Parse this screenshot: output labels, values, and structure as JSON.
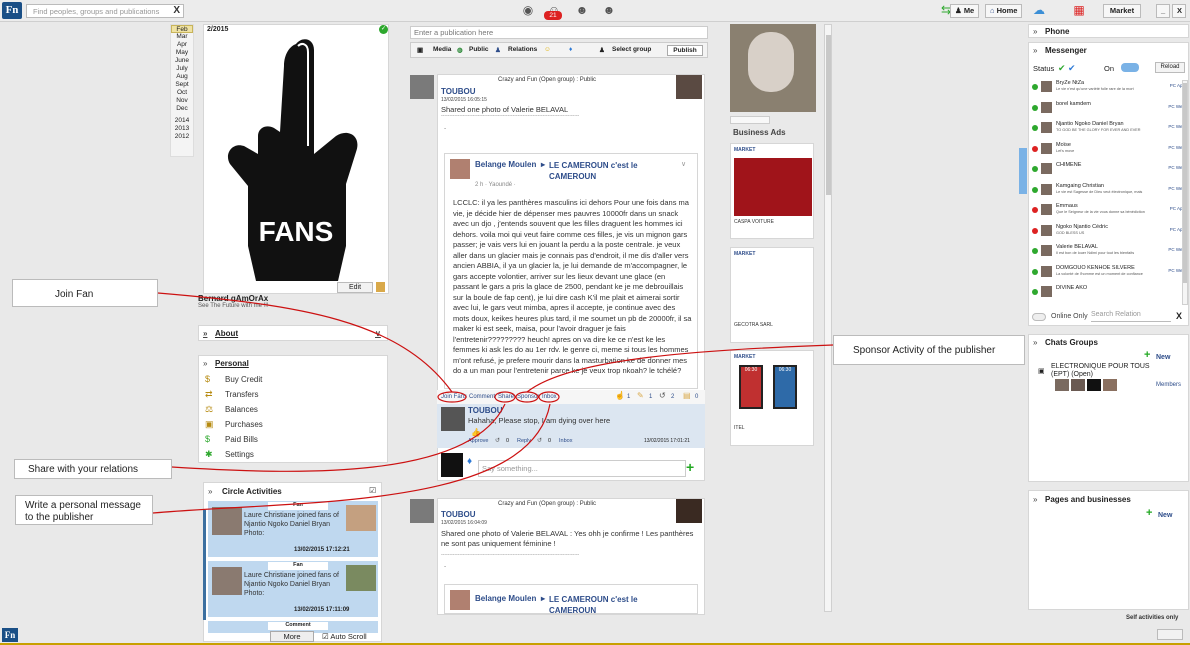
{
  "topbar": {
    "logo": "Fn",
    "search_placeholder": "Find peoples, groups and publications",
    "notif_count": "21",
    "me": "Me",
    "home": "Home",
    "market": "Market",
    "minimize": "_",
    "close": "X"
  },
  "calendar": {
    "months": [
      "Feb",
      "Mar",
      "Apr",
      "May",
      "June",
      "July",
      "Aug",
      "Sept",
      "Oct",
      "Nov",
      "Dec"
    ],
    "years": [
      "2014",
      "2013",
      "2012"
    ]
  },
  "profile": {
    "date": "2/2015",
    "edit": "Edit",
    "name": "Bernard gAmOrAx",
    "motto": "See The Future with me !!!",
    "fans_label": "FANS"
  },
  "about": {
    "title": "About"
  },
  "personal": {
    "title": "Personal",
    "items": [
      "Buy Credit",
      "Transfers",
      "Balances",
      "Purchases",
      "Paid Bills",
      "Settings"
    ]
  },
  "circle": {
    "title": "Circle Activities",
    "activities": [
      {
        "tag": "Fan",
        "text": "Laure Christiane joined fans of  Njantio Ngoko Daniel Bryan Photo:",
        "date": "13/02/2015 17:12:21"
      },
      {
        "tag": "Fan",
        "text": "Laure Christiane joined fans of  Njantio Ngoko Daniel Bryan Photo:",
        "date": "13/02/2015 17:11:09"
      }
    ],
    "third_tag": "Comment",
    "more": "More",
    "autoscroll": "Auto Scroll"
  },
  "composer": {
    "placeholder": "Enter a publication here",
    "media": "Media",
    "public": "Public",
    "relations": "Relations",
    "select_group": "Select group",
    "publish": "Publish"
  },
  "post1": {
    "author": "TOUBOU",
    "group": "Crazy and Fun (Open group) : Public",
    "time": "13/02/2015 16:05:15",
    "text": "Shared one photo of  Valerie BELAVAL",
    "dashes": "-----------------------------------------------------------------------------------",
    "dot": ".",
    "inner_author": "Belange Moulen",
    "inner_group": "LE CAMEROUN c'est le CAMEROUN",
    "inner_time": "2 h · Yaoundé ·",
    "inner_text": "LCCLC: il ya les panthères masculins ici dehors\nPour une fois dans ma vie, je décide hier de dépenser mes pauvres 10000fr dans un snack avec un djo , j'entends souvent que les filles draguent les hommes ici dehors. voila moi qui veut faire comme ces filles, je vis un mignon gars passer; je vais vers lui en jouant la perdu a la poste centrale. je veux aller dans un glacier mais je connais pas d'endroit, il me dis d'aller vers ancien ABBIA, il ya un glacier la, je lui demande de m'accompagner, le gars accepte volontier, arriver sur les lieux devant une glace (en passant le gars a pris la glace de 2500, pendant ke je me debrouillais sur la boule de fap cent), je lui dire cash K'il me plait et aimerai sortir avec lui, le gars veut mimba, apres il accepte, je continue avec des mots doux, keikes heures plus tard, il me soumet un pb de 20000fr, il sa maker ki est seek, maisa, pour l'avoir draguer je fais l'entretenir????????? heuch! apres on va dire ke ce n'est ke les femmes ki ask les do au 1er rdv. le genre ci, meme si tous les hommes m'ont refusé, je prefere mourir dans la masturbation ke de donner mes do a un man pour l'entretenir parce ke je veux trop nkoah? le tchélé?",
    "actions": [
      "Join Fans",
      "Comment",
      "Share",
      "Sponsor",
      "Inbox"
    ],
    "stats": [
      "1",
      "1",
      "2",
      "0"
    ],
    "comment_author": "TOUBOU",
    "comment_text": "Hahaha, Please stop, I am dying over here",
    "comment_actions": [
      "Approve",
      "0",
      "Reply",
      "0",
      "Inbox"
    ],
    "comment_time": "13/02/2015 17:01:21",
    "say_placeholder": "Say something..."
  },
  "post2": {
    "author": "TOUBOU",
    "group": "Crazy and Fun (Open group) : Public",
    "time": "13/02/2015 16:04:09",
    "text": "Shared one photo of  Valerie BELAVAL : Yes ohh je confirme ! Les panthères ne sont pas uniquement féminine !",
    "dashes": "-----------------------------------------------------------------------------------",
    "dot": ".",
    "inner_author": "Belange Moulen",
    "inner_group": "LE CAMEROUN c'est le CAMEROUN"
  },
  "ads": {
    "title": "Business Ads",
    "cards": [
      {
        "label": "MARKET",
        "caption": "CASPA VOITURE"
      },
      {
        "label": "MARKET",
        "caption": "GECOTRA SARL"
      },
      {
        "label": "MARKET",
        "caption": "ITEL"
      }
    ],
    "phone_time": "06:30"
  },
  "right": {
    "phone": "Phone",
    "messenger": "Messenger",
    "status": "Status",
    "on": "On",
    "reload": "Reload",
    "contacts": [
      {
        "name": "BryZe NtZa",
        "status": "Le vie n'est qu'une variété folle rare de la mort",
        "app": "PC App",
        "color": "#2ea82e"
      },
      {
        "name": "borel kamdem",
        "status": "",
        "app": "PC Web",
        "color": "#2ea82e"
      },
      {
        "name": "Njantio Ngoko Daniel Bryan",
        "status": "TO GOD BE THE GLORY FOR EVER AND EVER",
        "app": "PC Web",
        "color": "#2ea82e"
      },
      {
        "name": "Moïse",
        "status": "Let's move",
        "app": "PC Web",
        "color": "#d22"
      },
      {
        "name": "CHIMENE",
        "status": "",
        "app": "PC Web",
        "color": "#2ea82e"
      },
      {
        "name": "Kamgaing Christian",
        "status": "Le vie est Sagesse de Dieu veut électronique, mais",
        "app": "PC Web",
        "color": "#2ea82e"
      },
      {
        "name": "Emmaus",
        "status": "Que le Seigneur de la vie vous donne sa bénédiction",
        "app": "PC App",
        "color": "#d22"
      },
      {
        "name": "Ngoko Njantio Cédric",
        "status": "GOD BLESS US",
        "app": "PC App",
        "color": "#d22"
      },
      {
        "name": "Valerie BELAVAL",
        "status": "Il est bon de louer Ndimi pour tout les bienfaits",
        "app": "PC Web",
        "color": "#2ea82e"
      },
      {
        "name": "DOMGOUO KENHOE SILVERE",
        "status": "La volonté de l'homme est un moment de confiance",
        "app": "PC Web",
        "color": "#2ea82e"
      },
      {
        "name": "DIVINE AKO",
        "status": "",
        "app": "",
        "color": "#2ea82e"
      }
    ],
    "online_only": "Online Only",
    "search_relation": "Search Relation",
    "close": "X"
  },
  "chats": {
    "title": "Chats Groups",
    "new": "New",
    "group_name": "ELECTRONIQUE POUR TOUS (EPT) (Open)",
    "members": "Members"
  },
  "pages": {
    "title": "Pages and businesses",
    "new": "New"
  },
  "callouts": {
    "join_fan": "Join Fan",
    "sponsor": "Sponsor Activity of the publisher",
    "share": "Share with your relations",
    "message": "Write a personal message to the publisher"
  },
  "footer": {
    "self_activities": "Self activities only",
    "logo": "Fn"
  },
  "colors": {
    "accent_blue": "#2e4d8a",
    "annotation_red": "#cc1111",
    "online_green": "#2ea82e",
    "activity_blue": "#bfd8ef"
  }
}
